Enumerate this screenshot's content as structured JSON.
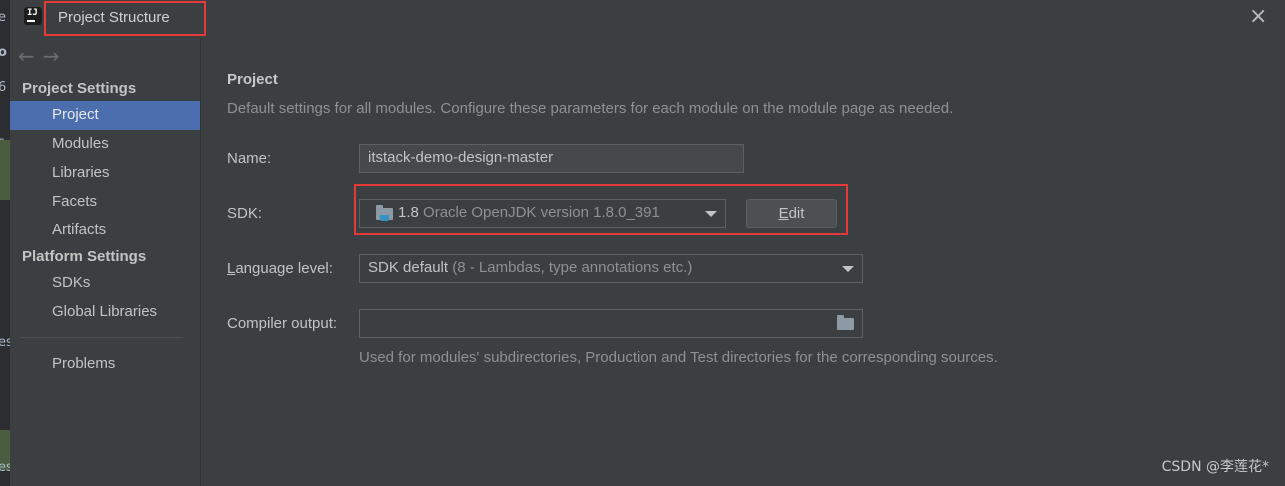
{
  "window": {
    "title": "Project Structure"
  },
  "background": {
    "chars": [
      "e",
      "o",
      "6",
      "s",
      "es",
      "es"
    ]
  },
  "sidebar": {
    "project_settings_heading": "Project Settings",
    "project_items": [
      "Project",
      "Modules",
      "Libraries",
      "Facets",
      "Artifacts"
    ],
    "platform_settings_heading": "Platform Settings",
    "platform_items": [
      "SDKs",
      "Global Libraries"
    ],
    "problems": "Problems",
    "selected": "Project"
  },
  "main": {
    "title": "Project",
    "description": "Default settings for all modules. Configure these parameters for each module on the module page as needed.",
    "name_label": "Name:",
    "name_value": "itstack-demo-design-master",
    "sdk_label": "SDK:",
    "sdk_version": "1.8",
    "sdk_detail": "Oracle OpenJDK version 1.8.0_391",
    "edit_prefix": "",
    "edit_mnemonic": "E",
    "edit_rest": "dit",
    "language_label_mnemonic": "L",
    "language_label_rest": "anguage level:",
    "language_value": "SDK default",
    "language_detail": "(8 - Lambdas, type annotations etc.)",
    "compiler_label": "Compiler output:",
    "compiler_value": "",
    "compiler_hint": "Used for modules' subdirectories, Production and Test directories for the corresponding sources."
  },
  "watermark": "CSDN @李莲花*",
  "colors": {
    "selection": "#4b6eaf",
    "highlight_box": "#e63a3a",
    "background": "#3c3f41"
  }
}
